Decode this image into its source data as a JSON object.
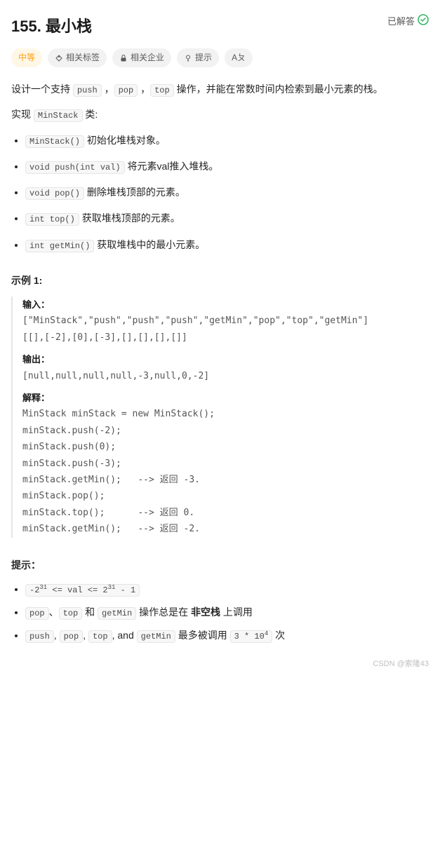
{
  "header": {
    "title": "155. 最小栈",
    "solved_label": "已解答"
  },
  "tags": {
    "difficulty": "中等",
    "related_tags": "相关标签",
    "related_companies": "相关企业",
    "hint": "提示",
    "translate": "Aㄆ"
  },
  "description": {
    "para1_pre": "设计一个支持 ",
    "push_code": "push",
    "para1_mid1": " ，",
    "pop_code": "pop",
    "para1_mid2": " ，",
    "top_code": "top",
    "para1_post": " 操作，并能在常数时间内检索到最小元素的栈。",
    "para2_pre": "实现 ",
    "minstack_code": "MinStack",
    "para2_post": " 类:"
  },
  "methods": [
    {
      "code": "MinStack()",
      "text": " 初始化堆栈对象。"
    },
    {
      "code": "void push(int val)",
      "text": " 将元素val推入堆栈。"
    },
    {
      "code": "void pop()",
      "text": " 删除堆栈顶部的元素。"
    },
    {
      "code": "int top()",
      "text": " 获取堆栈顶部的元素。"
    },
    {
      "code": "int getMin()",
      "text": " 获取堆栈中的最小元素。"
    }
  ],
  "example": {
    "title": "示例 1:",
    "input_label": "输入：",
    "input_line1": "[\"MinStack\",\"push\",\"push\",\"push\",\"getMin\",\"pop\",\"top\",\"getMin\"]",
    "input_line2": "[[],[-2],[0],[-3],[],[],[],[]]",
    "output_label": "输出：",
    "output_line": "[null,null,null,null,-3,null,0,-2]",
    "explain_label": "解释：",
    "explain_body": "MinStack minStack = new MinStack();\nminStack.push(-2);\nminStack.push(0);\nminStack.push(-3);\nminStack.getMin();   --> 返回 -3.\nminStack.pop();\nminStack.top();      --> 返回 0.\nminStack.getMin();   --> 返回 -2."
  },
  "constraints": {
    "title": "提示：",
    "c1_pre": "-2",
    "c1_exp1": "31",
    "c1_mid": " <= val <= 2",
    "c1_exp2": "31",
    "c1_post": " - 1",
    "c2_code1": "pop",
    "c2_sep1": "、",
    "c2_code2": "top",
    "c2_and": " 和 ",
    "c2_code3": "getMin",
    "c2_mid": " 操作总是在 ",
    "c2_bold": "非空栈",
    "c2_post": " 上调用",
    "c3_code1": "push",
    "c3_sep": ", ",
    "c3_code2": "pop",
    "c3_code3": "top",
    "c3_and": ", and ",
    "c3_code4": "getMin",
    "c3_mid": " 最多被调用 ",
    "c3_limit_pre": "3 * 10",
    "c3_limit_exp": "4",
    "c3_post": " 次"
  },
  "watermark": "CSDN @索隆43"
}
